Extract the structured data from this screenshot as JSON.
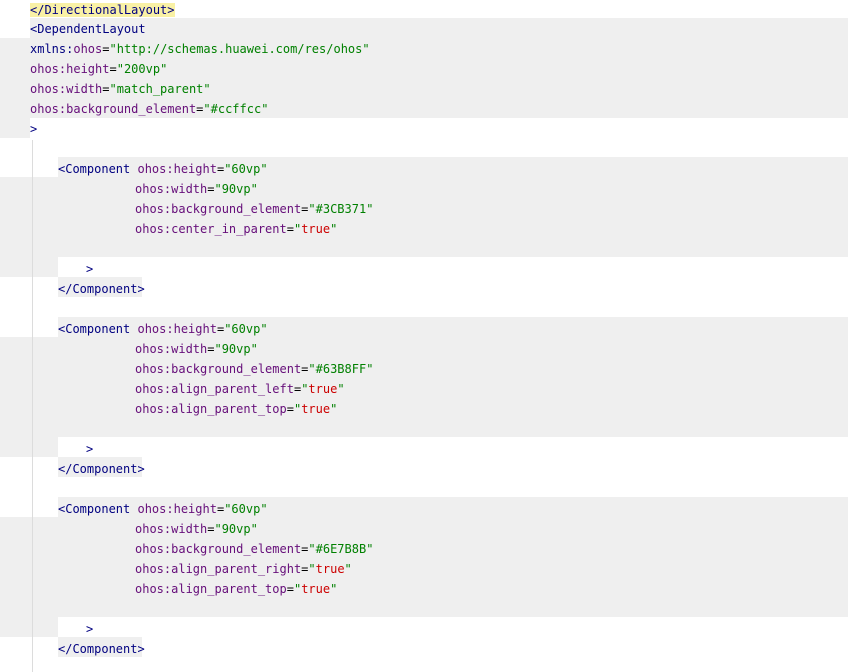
{
  "editor": {
    "language": "xml",
    "lines": [
      {
        "parts": [
          {
            "t": "</DirectionalLayout>",
            "c": "hl-tag"
          }
        ]
      },
      {
        "parts": [
          {
            "t": "<DependentLayout",
            "c": "tag"
          }
        ]
      },
      {
        "parts": [
          {
            "t": "xmlns:",
            "c": "ns"
          },
          {
            "t": "ohos",
            "c": "attr"
          },
          {
            "t": "=",
            "c": "punct"
          },
          {
            "t": "\"http://schemas.huawei.com/res/ohos\"",
            "c": "str"
          }
        ]
      },
      {
        "parts": [
          {
            "t": "ohos:height",
            "c": "attr"
          },
          {
            "t": "=",
            "c": "punct"
          },
          {
            "t": "\"200vp\"",
            "c": "str"
          }
        ]
      },
      {
        "parts": [
          {
            "t": "ohos:width",
            "c": "attr"
          },
          {
            "t": "=",
            "c": "punct"
          },
          {
            "t": "\"match_parent\"",
            "c": "str"
          }
        ]
      },
      {
        "parts": [
          {
            "t": "ohos:background_element",
            "c": "attr"
          },
          {
            "t": "=",
            "c": "punct"
          },
          {
            "t": "\"#ccffcc\"",
            "c": "str"
          }
        ]
      },
      {
        "parts": [
          {
            "t": ">",
            "c": "tag"
          }
        ]
      },
      {
        "parts": []
      },
      {
        "parts": [
          {
            "t": "<Component ",
            "c": "tag"
          },
          {
            "t": "ohos:height",
            "c": "attr"
          },
          {
            "t": "=",
            "c": "punct"
          },
          {
            "t": "\"60vp\"",
            "c": "str"
          }
        ]
      },
      {
        "parts": [
          {
            "t": "ohos:width",
            "c": "attr"
          },
          {
            "t": "=",
            "c": "punct"
          },
          {
            "t": "\"90vp\"",
            "c": "str"
          }
        ]
      },
      {
        "parts": [
          {
            "t": "ohos:background_element",
            "c": "attr"
          },
          {
            "t": "=",
            "c": "punct"
          },
          {
            "t": "\"#3CB371\"",
            "c": "str"
          }
        ]
      },
      {
        "parts": [
          {
            "t": "ohos:center_in_parent",
            "c": "attr"
          },
          {
            "t": "=",
            "c": "punct"
          },
          {
            "t": "\"",
            "c": "str"
          },
          {
            "t": "true",
            "c": "bool"
          },
          {
            "t": "\"",
            "c": "str"
          }
        ]
      },
      {
        "parts": []
      },
      {
        "parts": [
          {
            "t": ">",
            "c": "tag"
          }
        ]
      },
      {
        "parts": [
          {
            "t": "</Component>",
            "c": "tag"
          }
        ]
      },
      {
        "parts": []
      },
      {
        "parts": [
          {
            "t": "<Component ",
            "c": "tag"
          },
          {
            "t": "ohos:height",
            "c": "attr"
          },
          {
            "t": "=",
            "c": "punct"
          },
          {
            "t": "\"60vp\"",
            "c": "str"
          }
        ]
      },
      {
        "parts": [
          {
            "t": "ohos:width",
            "c": "attr"
          },
          {
            "t": "=",
            "c": "punct"
          },
          {
            "t": "\"90vp\"",
            "c": "str"
          }
        ]
      },
      {
        "parts": [
          {
            "t": "ohos:background_element",
            "c": "attr"
          },
          {
            "t": "=",
            "c": "punct"
          },
          {
            "t": "\"#63B8FF\"",
            "c": "str"
          }
        ]
      },
      {
        "parts": [
          {
            "t": "ohos:align_parent_left",
            "c": "attr"
          },
          {
            "t": "=",
            "c": "punct"
          },
          {
            "t": "\"",
            "c": "str"
          },
          {
            "t": "true",
            "c": "bool"
          },
          {
            "t": "\"",
            "c": "str"
          }
        ]
      },
      {
        "parts": [
          {
            "t": "ohos:align_parent_top",
            "c": "attr"
          },
          {
            "t": "=",
            "c": "punct"
          },
          {
            "t": "\"",
            "c": "str"
          },
          {
            "t": "true",
            "c": "bool"
          },
          {
            "t": "\"",
            "c": "str"
          }
        ]
      },
      {
        "parts": []
      },
      {
        "parts": [
          {
            "t": ">",
            "c": "tag"
          }
        ]
      },
      {
        "parts": [
          {
            "t": "</Component>",
            "c": "tag"
          }
        ]
      },
      {
        "parts": []
      },
      {
        "parts": [
          {
            "t": "<Component ",
            "c": "tag"
          },
          {
            "t": "ohos:height",
            "c": "attr"
          },
          {
            "t": "=",
            "c": "punct"
          },
          {
            "t": "\"60vp\"",
            "c": "str"
          }
        ]
      },
      {
        "parts": [
          {
            "t": "ohos:width",
            "c": "attr"
          },
          {
            "t": "=",
            "c": "punct"
          },
          {
            "t": "\"90vp\"",
            "c": "str"
          }
        ]
      },
      {
        "parts": [
          {
            "t": "ohos:background_element",
            "c": "attr"
          },
          {
            "t": "=",
            "c": "punct"
          },
          {
            "t": "\"#6E7B8B\"",
            "c": "str"
          }
        ]
      },
      {
        "parts": [
          {
            "t": "ohos:align_parent_right",
            "c": "attr"
          },
          {
            "t": "=",
            "c": "punct"
          },
          {
            "t": "\"",
            "c": "str"
          },
          {
            "t": "true",
            "c": "bool"
          },
          {
            "t": "\"",
            "c": "str"
          }
        ]
      },
      {
        "parts": [
          {
            "t": "ohos:align_parent_top",
            "c": "attr"
          },
          {
            "t": "=",
            "c": "punct"
          },
          {
            "t": "\"",
            "c": "str"
          },
          {
            "t": "true",
            "c": "bool"
          },
          {
            "t": "\"",
            "c": "str"
          }
        ]
      },
      {
        "parts": []
      },
      {
        "parts": [
          {
            "t": ">",
            "c": "tag"
          }
        ]
      },
      {
        "parts": [
          {
            "t": "</Component>",
            "c": "tag"
          }
        ]
      }
    ],
    "colors": {
      "tag": "#000080",
      "attr": "#660e7a",
      "string": "#008000",
      "boolean": "#cc0000",
      "block_background": "#efefef",
      "tag_highlight": "#f9f1a5"
    }
  }
}
